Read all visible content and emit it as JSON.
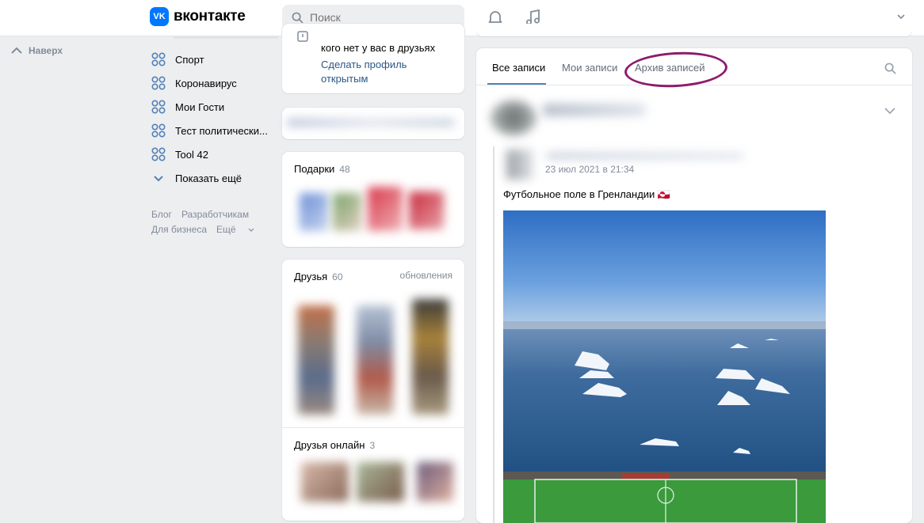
{
  "header": {
    "logo_mark": "VK",
    "logo_text": "вконтакте",
    "search_placeholder": "Поиск"
  },
  "back_up": {
    "label": "Наверх"
  },
  "left_nav": {
    "items": [
      {
        "label": "Спорт"
      },
      {
        "label": "Коронавирус"
      },
      {
        "label": "Мои Гости"
      },
      {
        "label": "Тест политически..."
      },
      {
        "label": "Tool 42"
      }
    ],
    "more": "Показать ещё"
  },
  "footer_links": {
    "blog": "Блог",
    "developers": "Разработчикам",
    "business": "Для бизнеса",
    "more": "Ещё"
  },
  "privacy_card": {
    "text": "кого нет у вас в друзьях",
    "link": "Сделать профиль открытым"
  },
  "gifts": {
    "title": "Подарки",
    "count": "48"
  },
  "friends": {
    "title": "Друзья",
    "count": "60",
    "updates": "обновления"
  },
  "friends_online": {
    "title": "Друзья онлайн",
    "count": "3"
  },
  "feed": {
    "tabs": [
      {
        "label": "Все записи",
        "active": true
      },
      {
        "label": "Мои записи",
        "active": false
      },
      {
        "label": "Архив записей",
        "active": false
      }
    ],
    "post": {
      "date": "23 июл 2021 в 21:34",
      "text": "Футбольное поле в Гренландии 🇬🇱"
    }
  },
  "colors": {
    "accent": "#0077ff",
    "link": "#2a5885",
    "annotation_circle": "#8e1a6b"
  }
}
